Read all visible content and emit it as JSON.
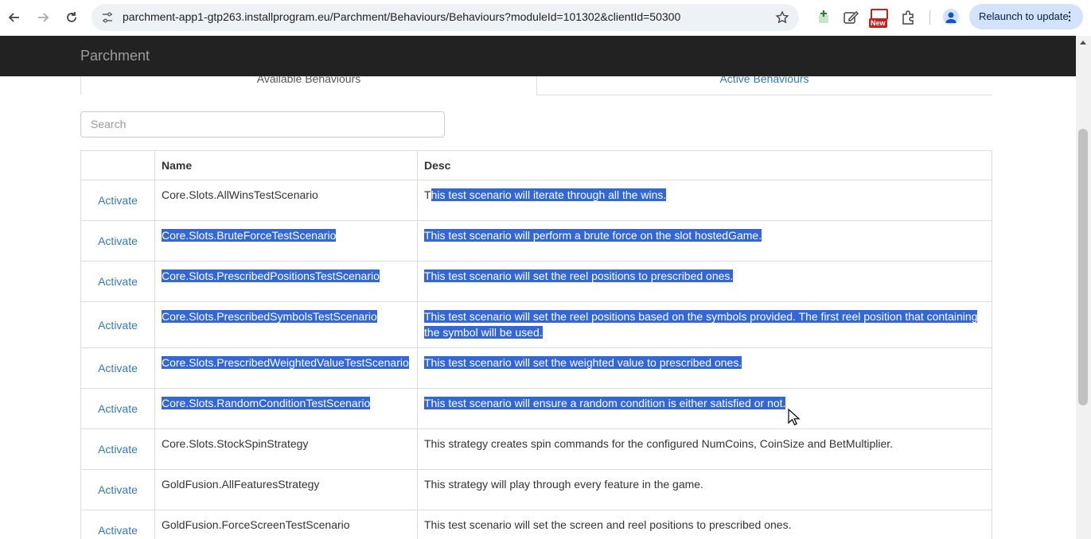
{
  "browser": {
    "url": "parchment-app1-gtp263.installprogram.eu/Parchment/Behaviours/Behaviours?moduleId=101302&clientId=50300",
    "new_badge": "New",
    "relaunch_label": "Relaunch to update"
  },
  "app": {
    "brand": "Parchment"
  },
  "tabs": {
    "available": "Available Behaviours",
    "active": "Active Behaviours"
  },
  "search": {
    "placeholder": "Search"
  },
  "table": {
    "headers": {
      "action": "",
      "name": "Name",
      "desc": "Desc"
    },
    "rows": [
      {
        "action": "Activate",
        "name": "Core.Slots.AllWinsTestScenario",
        "desc_first": "T",
        "desc": "his test scenario will iterate through all the wins."
      },
      {
        "action": "Activate",
        "name": "Core.Slots.BruteForceTestScenario",
        "desc": "This test scenario will perform a brute force on the slot hostedGame."
      },
      {
        "action": "Activate",
        "name": "Core.Slots.PrescribedPositionsTestScenario",
        "desc": "This test scenario will set the reel positions to prescribed ones."
      },
      {
        "action": "Activate",
        "name": "Core.Slots.PrescribedSymbolsTestScenario",
        "desc": "This test scenario will set the reel positions based on the symbols provided. The first reel position that containing the symbol will be used."
      },
      {
        "action": "Activate",
        "name": "Core.Slots.PrescribedWeightedValueTestScenario",
        "desc": "This test scenario will set the weighted value to prescribed ones."
      },
      {
        "action": "Activate",
        "name": "Core.Slots.RandomConditionTestScenario",
        "desc": "This test scenario will ensure a random condition is either satisfied or not."
      },
      {
        "action": "Activate",
        "name": "Core.Slots.StockSpinStrategy",
        "desc": "This strategy creates spin commands for the configured NumCoins, CoinSize and BetMultiplier."
      },
      {
        "action": "Activate",
        "name": "GoldFusion.AllFeaturesStrategy",
        "desc": "This strategy will play through every feature in the game."
      },
      {
        "action": "Activate",
        "name": "GoldFusion.ForceScreenTestScenario",
        "desc": "This test scenario will set the screen and reel positions to prescribed ones."
      }
    ]
  },
  "colors": {
    "selection": "#3367d6",
    "link": "#337ab7",
    "navbar": "#222222"
  }
}
